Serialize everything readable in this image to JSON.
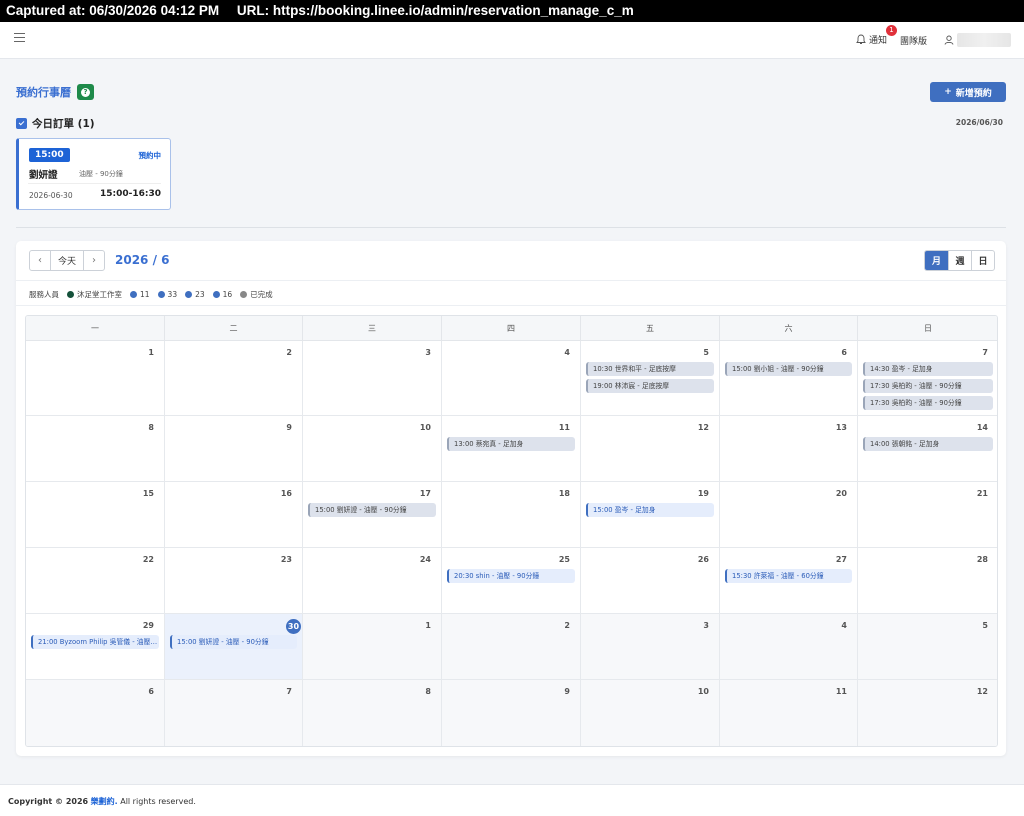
{
  "capture": {
    "captured_at": "Captured at: 06/30/2026 04:12 PM",
    "url": "URL: https://booking.linee.io/admin/reservation_manage_c_m"
  },
  "topbar": {
    "notify_label": "通知",
    "notify_count": "1",
    "version_label": "團隊版"
  },
  "page": {
    "title": "預約行事曆",
    "add_button": "新增預約",
    "today_heading": "今日訂單 (1)",
    "today_date": "2026/06/30"
  },
  "today_order": {
    "time": "15:00",
    "status": "預約中",
    "name": "劉妍證",
    "service": "油壓 - 90分鐘",
    "date": "2026-06-30",
    "range": "15:00-16:30"
  },
  "calendar": {
    "today_button": "今天",
    "title": "2026 / 6",
    "views": [
      "月",
      "週",
      "日"
    ],
    "legend_label": "服務人員",
    "legend": [
      {
        "label": "沐足堂工作室",
        "color": "#14513a"
      },
      {
        "label": "11",
        "color": "#3f6fc0"
      },
      {
        "label": "33",
        "color": "#3f6fc0"
      },
      {
        "label": "23",
        "color": "#3f6fc0"
      },
      {
        "label": "16",
        "color": "#3f6fc0"
      },
      {
        "label": "已完成",
        "color": "#888888"
      }
    ],
    "weekdays": [
      "一",
      "二",
      "三",
      "四",
      "五",
      "六",
      "日"
    ],
    "weeks": [
      [
        {
          "day": "1"
        },
        {
          "day": "2"
        },
        {
          "day": "3"
        },
        {
          "day": "4"
        },
        {
          "day": "5",
          "events": [
            {
              "text": "10:30 世界和平 - 足底按摩"
            },
            {
              "text": "19:00 林沛宸 - 足底按摩"
            }
          ]
        },
        {
          "day": "6",
          "events": [
            {
              "text": "15:00 劉小姐 - 油壓 - 90分鐘"
            }
          ]
        },
        {
          "day": "7",
          "events": [
            {
              "text": "14:30 盈岑 - 足加身"
            },
            {
              "text": "17:30 吳柏昀 - 油壓 - 90分鐘"
            },
            {
              "text": "17:30 吳柏昀 - 油壓 - 90分鐘"
            }
          ]
        }
      ],
      [
        {
          "day": "8"
        },
        {
          "day": "9"
        },
        {
          "day": "10"
        },
        {
          "day": "11",
          "events": [
            {
              "text": "13:00 蔡宛真 - 足加身"
            }
          ]
        },
        {
          "day": "12"
        },
        {
          "day": "13"
        },
        {
          "day": "14",
          "events": [
            {
              "text": "14:00 張朝銘 - 足加身"
            }
          ]
        }
      ],
      [
        {
          "day": "15"
        },
        {
          "day": "16"
        },
        {
          "day": "17",
          "events": [
            {
              "text": "15:00 劉妍證 - 油壓 - 90分鐘"
            }
          ]
        },
        {
          "day": "18"
        },
        {
          "day": "19",
          "events": [
            {
              "text": "15:00 盈岑 - 足加身",
              "active": true
            }
          ]
        },
        {
          "day": "20"
        },
        {
          "day": "21"
        }
      ],
      [
        {
          "day": "22"
        },
        {
          "day": "23"
        },
        {
          "day": "24"
        },
        {
          "day": "25",
          "events": [
            {
              "text": "20:30 shin - 油壓 - 90分鐘",
              "active": true
            }
          ]
        },
        {
          "day": "26"
        },
        {
          "day": "27",
          "events": [
            {
              "text": "15:30 許萊福 - 油壓 - 60分鐘",
              "active": true
            }
          ]
        },
        {
          "day": "28"
        }
      ],
      [
        {
          "day": "29",
          "events": [
            {
              "text": "21:00 Byzoom Philip 吳管儀 - 油壓 - 90分鐘",
              "active": true
            }
          ]
        },
        {
          "day": "30",
          "today": true,
          "events": [
            {
              "text": "15:00 劉妍證 - 油壓 - 90分鐘",
              "active": true
            }
          ]
        },
        {
          "day": "1",
          "other": true
        },
        {
          "day": "2",
          "other": true
        },
        {
          "day": "3",
          "other": true
        },
        {
          "day": "4",
          "other": true
        },
        {
          "day": "5",
          "other": true
        }
      ],
      [
        {
          "day": "6",
          "other": true
        },
        {
          "day": "7",
          "other": true
        },
        {
          "day": "8",
          "other": true
        },
        {
          "day": "9",
          "other": true
        },
        {
          "day": "10",
          "other": true
        },
        {
          "day": "11",
          "other": true
        },
        {
          "day": "12",
          "other": true
        }
      ]
    ]
  },
  "footer": {
    "copyright": "Copyright © 2026",
    "brand": "樂劃約.",
    "rights": "All rights reserved."
  }
}
